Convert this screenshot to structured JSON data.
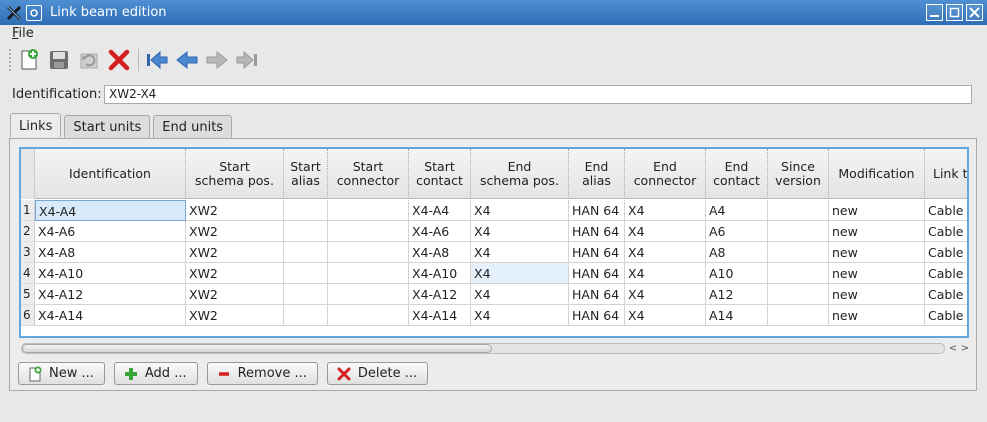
{
  "window": {
    "title": "Link beam edition"
  },
  "menu": {
    "file_prefix": "F",
    "file_rest": "ile"
  },
  "toolbar": {
    "buttons": [
      "new-document-icon",
      "save-icon",
      "undo-icon",
      "delete-icon",
      "first-icon",
      "previous-icon",
      "next-icon",
      "last-icon"
    ]
  },
  "identification": {
    "label": "Identification:",
    "value": "XW2-X4"
  },
  "tabs": [
    {
      "label": "Links"
    },
    {
      "label": "Start units"
    },
    {
      "label": "End units"
    }
  ],
  "table": {
    "columns": [
      "Identification",
      "Start\nschema pos.",
      "Start\nalias",
      "Start\nconnector",
      "Start\ncontact",
      "End\nschema pos.",
      "End\nalias",
      "End\nconnector",
      "End\ncontact",
      "Since\nversion",
      "Modification",
      "Link ty"
    ],
    "rows": [
      {
        "num": "1",
        "cells": [
          "X4-A4",
          "XW2",
          "",
          "",
          "X4-A4",
          "X4",
          "HAN 64",
          "X4",
          "A4",
          "",
          "new",
          "Cable I"
        ]
      },
      {
        "num": "2",
        "cells": [
          "X4-A6",
          "XW2",
          "",
          "",
          "X4-A6",
          "X4",
          "HAN 64",
          "X4",
          "A6",
          "",
          "new",
          "Cable I"
        ]
      },
      {
        "num": "3",
        "cells": [
          "X4-A8",
          "XW2",
          "",
          "",
          "X4-A8",
          "X4",
          "HAN 64",
          "X4",
          "A8",
          "",
          "new",
          "Cable I"
        ]
      },
      {
        "num": "4",
        "cells": [
          "X4-A10",
          "XW2",
          "",
          "",
          "X4-A10",
          "X4",
          "HAN 64",
          "X4",
          "A10",
          "",
          "new",
          "Cable I"
        ]
      },
      {
        "num": "5",
        "cells": [
          "X4-A12",
          "XW2",
          "",
          "",
          "X4-A12",
          "X4",
          "HAN 64",
          "X4",
          "A12",
          "",
          "new",
          "Cable I"
        ]
      },
      {
        "num": "6",
        "cells": [
          "X4-A14",
          "XW2",
          "",
          "",
          "X4-A14",
          "X4",
          "HAN 64",
          "X4",
          "A14",
          "",
          "new",
          "Cable I"
        ]
      }
    ]
  },
  "actions": {
    "new_label": "New ...",
    "add_label": "Add ...",
    "remove_label": "Remove ...",
    "delete_label": "Delete ..."
  },
  "colors": {
    "titlebar": "#3a7cc4",
    "selection_border": "#62a8e0",
    "delete_red": "#d42020"
  }
}
